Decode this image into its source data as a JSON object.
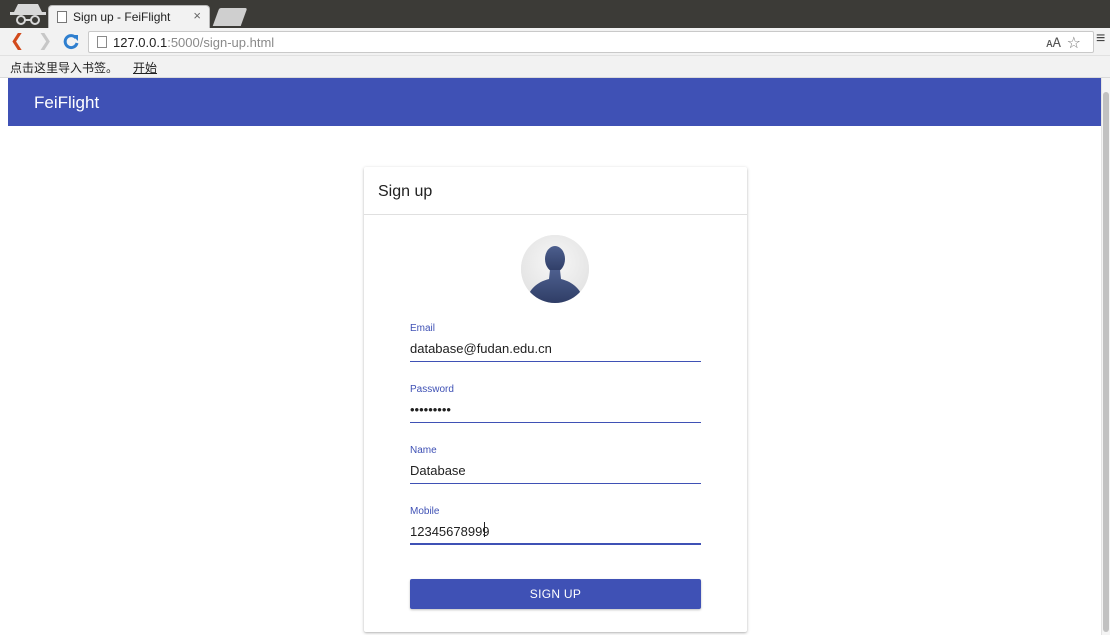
{
  "browser": {
    "tab_title": "Sign up - FeiFlight",
    "tab_close": "×",
    "url_host": "127.0.0.1",
    "url_rest": ":5000/sign-up.html",
    "bookmark_prompt": "点击这里导入书签。",
    "bookmark_link": "开始"
  },
  "app": {
    "brand": "FeiFlight",
    "primary_color": "#3f51b5"
  },
  "signup_card": {
    "title": "Sign up",
    "fields": {
      "email": {
        "label": "Email",
        "value": "database@fudan.edu.cn"
      },
      "password": {
        "label": "Password",
        "value": "•••••••••"
      },
      "name": {
        "label": "Name",
        "value": "Database"
      },
      "mobile": {
        "label": "Mobile",
        "value": "12345678999"
      }
    },
    "submit_label": "SIGN UP"
  }
}
